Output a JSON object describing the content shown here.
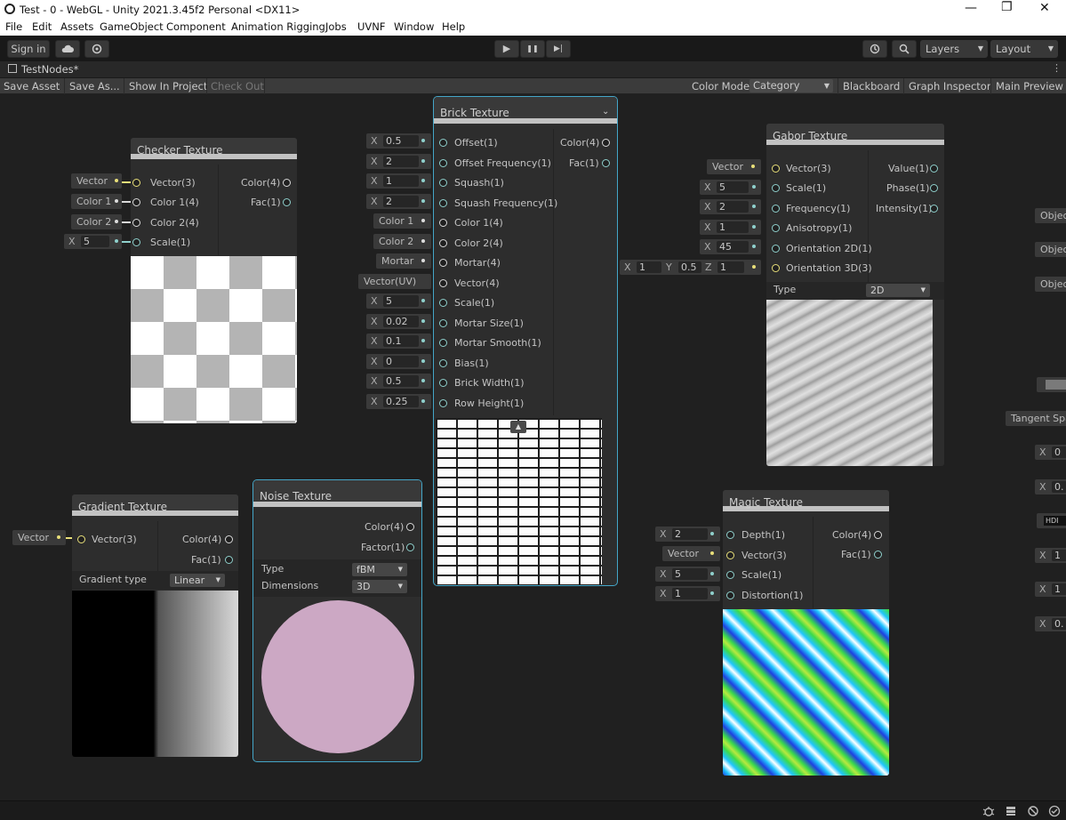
{
  "window": {
    "title": "Test - 0 - WebGL - Unity 2021.3.45f2 Personal <DX11>",
    "minimize": "—",
    "maximize": "❐",
    "close": "✕"
  },
  "menu": [
    "File",
    "Edit",
    "Assets",
    "GameObject",
    "Component",
    "Animation Rigging",
    "Jobs",
    "UVNF",
    "Window",
    "Help"
  ],
  "toolbar": {
    "sign_in": "Sign in",
    "layers": "Layers",
    "layout": "Layout",
    "play": "▶",
    "pause": "❚❚",
    "step": "▶|"
  },
  "tab": {
    "title": "TestNodes*"
  },
  "graph_toolbar": {
    "save_asset": "Save Asset",
    "save_as": "Save As...",
    "show_in_project": "Show In Project",
    "check_out": "Check Out",
    "color_mode_label": "Color Mode",
    "color_mode_value": "Category",
    "blackboard": "Blackboard",
    "graph_inspector": "Graph Inspector",
    "main_preview": "Main Preview"
  },
  "checker": {
    "title": "Checker Texture",
    "inputs": [
      "Vector(3)",
      "Color 1(4)",
      "Color 2(4)",
      "Scale(1)"
    ],
    "outputs": [
      "Color(4)",
      "Fac(1)"
    ],
    "fields": [
      "Vector",
      "Color 1",
      "Color 2"
    ],
    "scale_x": "X",
    "scale_value": "5"
  },
  "brick": {
    "title": "Brick Texture",
    "inputs": [
      "Offset(1)",
      "Offset Frequency(1)",
      "Squash(1)",
      "Squash Frequency(1)",
      "Color 1(4)",
      "Color 2(4)",
      "Mortar(4)",
      "Vector(4)",
      "Scale(1)",
      "Mortar Size(1)",
      "Mortar Smooth(1)",
      "Bias(1)",
      "Brick Width(1)",
      "Row Height(1)"
    ],
    "outputs": [
      "Color(4)",
      "Fac(1)"
    ],
    "x_label": "X",
    "values": [
      "0.5",
      "2",
      "1",
      "2",
      "5",
      "0.02",
      "0.1",
      "0",
      "0.5",
      "0.25"
    ],
    "fields": [
      "Color 1",
      "Color 2",
      "Mortar",
      "Vector(UV)"
    ]
  },
  "gabor": {
    "title": "Gabor Texture",
    "inputs": [
      "Vector(3)",
      "Scale(1)",
      "Frequency(1)",
      "Anisotropy(1)",
      "Orientation 2D(1)",
      "Orientation 3D(3)"
    ],
    "outputs": [
      "Value(1)",
      "Phase(1)",
      "Intensity(1)"
    ],
    "vector_field": "Vector",
    "x_label": "X",
    "values": [
      "5",
      "2",
      "1",
      "45"
    ],
    "orient3d": {
      "x_label": "X",
      "x": "1",
      "y_label": "Y",
      "y": "0.5",
      "z_label": "Z",
      "z": "1"
    },
    "type_label": "Type",
    "type_value": "2D"
  },
  "gradient": {
    "title": "Gradient Texture",
    "inputs": [
      "Vector(3)"
    ],
    "outputs": [
      "Color(4)",
      "Fac(1)"
    ],
    "vector_field": "Vector",
    "type_label": "Gradient type",
    "type_value": "Linear"
  },
  "noise": {
    "title": "Noise Texture",
    "outputs": [
      "Color(4)",
      "Factor(1)"
    ],
    "type_label": "Type",
    "type_value": "fBM",
    "dim_label": "Dimensions",
    "dim_value": "3D",
    "preview_color": "#cca8c4"
  },
  "magic": {
    "title": "Magic Texture",
    "inputs": [
      "Depth(1)",
      "Vector(3)",
      "Scale(1)",
      "Distortion(1)"
    ],
    "outputs": [
      "Color(4)",
      "Fac(1)"
    ],
    "x_label": "X",
    "depth": "2",
    "vector_field": "Vector",
    "scale": "5",
    "distortion": "1"
  },
  "right_edge": {
    "obj": [
      "Objec",
      "Objec",
      "Objec"
    ],
    "tangent": "Tangent Spa",
    "hdr": "HDI",
    "x_label": "X",
    "values": [
      "0",
      "0.",
      "1",
      "1",
      "0."
    ]
  },
  "colors": {
    "accent_selected": "#44a6c8",
    "pin_float": "#8fd0cc",
    "pin_vector": "#e8df79",
    "pin_color": "#d8d8d8"
  }
}
